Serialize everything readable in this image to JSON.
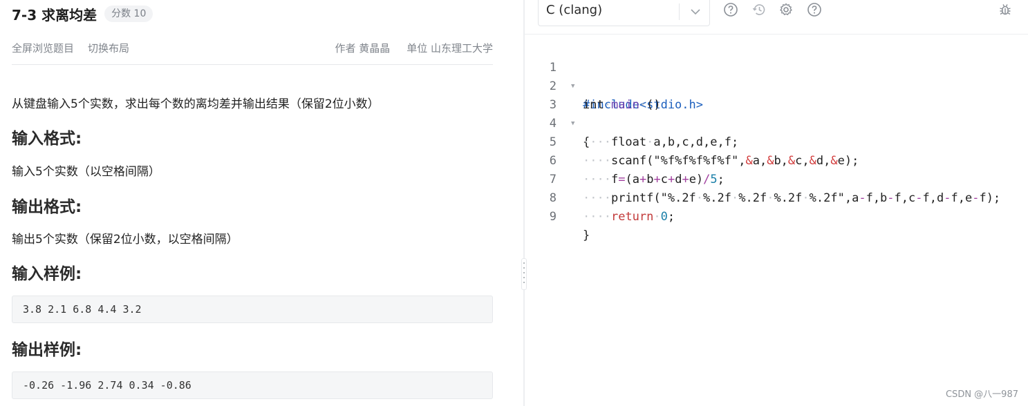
{
  "problem": {
    "title": "7-3 求离均差",
    "score_badge": "分数 10",
    "actions": [
      "全屏浏览题目",
      "切换布局"
    ],
    "author": "作者 黄晶晶",
    "unit": "单位 山东理工大学",
    "description": "从键盘输入5个实数，求出每个数的离均差并输出结果（保留2位小数）",
    "input_format_heading": "输入格式:",
    "input_format_text": "输入5个实数（以空格间隔）",
    "output_format_heading": "输出格式:",
    "output_format_text": "输出5个实数（保留2位小数，以空格间隔）",
    "sample_input_heading": "输入样例:",
    "sample_input": "3.8 2.1 6.8 4.4 3.2",
    "sample_output_heading": "输出样例:",
    "sample_output": "-0.26 -1.96 2.74 0.34 -0.86"
  },
  "editor": {
    "language": "C (clang)",
    "toolbar_icons": [
      "help-circle-icon",
      "history-icon",
      "settings-gear-icon",
      "help-circle-icon",
      "bug-icon"
    ],
    "line_numbers": [
      "1",
      "2",
      "3",
      "4",
      "5",
      "6",
      "7",
      "8",
      "9"
    ],
    "code_lines": [
      "#include<stdio.h>",
      "int main ()",
      "{",
      "    float a,b,c,d,e,f;",
      "    scanf(\"%f%f%f%f%f\",&a,&b,&c,&d,&e);",
      "    f=(a+b+c+d+e)/5;",
      "    printf(\"%.2f %.2f %.2f %.2f %.2f\",a-f,b-f,c-f,d-f,e-f);",
      "    return 0;",
      "}"
    ]
  },
  "watermark": "CSDN @八一987",
  "colors": {
    "accent_preprocessor": "#1c5fbd",
    "function_name": "#6d43b0",
    "ampersand": "#d23b3b",
    "number": "#1a7fa8"
  }
}
